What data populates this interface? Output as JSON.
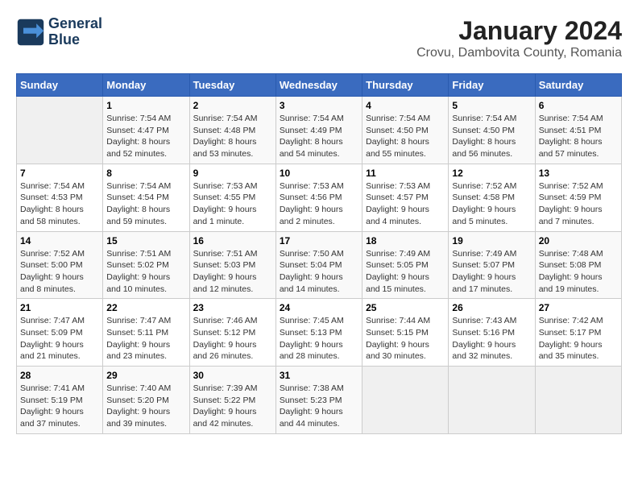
{
  "header": {
    "logo_line1": "General",
    "logo_line2": "Blue",
    "title": "January 2024",
    "subtitle": "Crovu, Dambovita County, Romania"
  },
  "weekdays": [
    "Sunday",
    "Monday",
    "Tuesday",
    "Wednesday",
    "Thursday",
    "Friday",
    "Saturday"
  ],
  "weeks": [
    [
      {
        "day": "",
        "info": ""
      },
      {
        "day": "1",
        "info": "Sunrise: 7:54 AM\nSunset: 4:47 PM\nDaylight: 8 hours\nand 52 minutes."
      },
      {
        "day": "2",
        "info": "Sunrise: 7:54 AM\nSunset: 4:48 PM\nDaylight: 8 hours\nand 53 minutes."
      },
      {
        "day": "3",
        "info": "Sunrise: 7:54 AM\nSunset: 4:49 PM\nDaylight: 8 hours\nand 54 minutes."
      },
      {
        "day": "4",
        "info": "Sunrise: 7:54 AM\nSunset: 4:50 PM\nDaylight: 8 hours\nand 55 minutes."
      },
      {
        "day": "5",
        "info": "Sunrise: 7:54 AM\nSunset: 4:50 PM\nDaylight: 8 hours\nand 56 minutes."
      },
      {
        "day": "6",
        "info": "Sunrise: 7:54 AM\nSunset: 4:51 PM\nDaylight: 8 hours\nand 57 minutes."
      }
    ],
    [
      {
        "day": "7",
        "info": "Sunrise: 7:54 AM\nSunset: 4:53 PM\nDaylight: 8 hours\nand 58 minutes."
      },
      {
        "day": "8",
        "info": "Sunrise: 7:54 AM\nSunset: 4:54 PM\nDaylight: 8 hours\nand 59 minutes."
      },
      {
        "day": "9",
        "info": "Sunrise: 7:53 AM\nSunset: 4:55 PM\nDaylight: 9 hours\nand 1 minute."
      },
      {
        "day": "10",
        "info": "Sunrise: 7:53 AM\nSunset: 4:56 PM\nDaylight: 9 hours\nand 2 minutes."
      },
      {
        "day": "11",
        "info": "Sunrise: 7:53 AM\nSunset: 4:57 PM\nDaylight: 9 hours\nand 4 minutes."
      },
      {
        "day": "12",
        "info": "Sunrise: 7:52 AM\nSunset: 4:58 PM\nDaylight: 9 hours\nand 5 minutes."
      },
      {
        "day": "13",
        "info": "Sunrise: 7:52 AM\nSunset: 4:59 PM\nDaylight: 9 hours\nand 7 minutes."
      }
    ],
    [
      {
        "day": "14",
        "info": "Sunrise: 7:52 AM\nSunset: 5:00 PM\nDaylight: 9 hours\nand 8 minutes."
      },
      {
        "day": "15",
        "info": "Sunrise: 7:51 AM\nSunset: 5:02 PM\nDaylight: 9 hours\nand 10 minutes."
      },
      {
        "day": "16",
        "info": "Sunrise: 7:51 AM\nSunset: 5:03 PM\nDaylight: 9 hours\nand 12 minutes."
      },
      {
        "day": "17",
        "info": "Sunrise: 7:50 AM\nSunset: 5:04 PM\nDaylight: 9 hours\nand 14 minutes."
      },
      {
        "day": "18",
        "info": "Sunrise: 7:49 AM\nSunset: 5:05 PM\nDaylight: 9 hours\nand 15 minutes."
      },
      {
        "day": "19",
        "info": "Sunrise: 7:49 AM\nSunset: 5:07 PM\nDaylight: 9 hours\nand 17 minutes."
      },
      {
        "day": "20",
        "info": "Sunrise: 7:48 AM\nSunset: 5:08 PM\nDaylight: 9 hours\nand 19 minutes."
      }
    ],
    [
      {
        "day": "21",
        "info": "Sunrise: 7:47 AM\nSunset: 5:09 PM\nDaylight: 9 hours\nand 21 minutes."
      },
      {
        "day": "22",
        "info": "Sunrise: 7:47 AM\nSunset: 5:11 PM\nDaylight: 9 hours\nand 23 minutes."
      },
      {
        "day": "23",
        "info": "Sunrise: 7:46 AM\nSunset: 5:12 PM\nDaylight: 9 hours\nand 26 minutes."
      },
      {
        "day": "24",
        "info": "Sunrise: 7:45 AM\nSunset: 5:13 PM\nDaylight: 9 hours\nand 28 minutes."
      },
      {
        "day": "25",
        "info": "Sunrise: 7:44 AM\nSunset: 5:15 PM\nDaylight: 9 hours\nand 30 minutes."
      },
      {
        "day": "26",
        "info": "Sunrise: 7:43 AM\nSunset: 5:16 PM\nDaylight: 9 hours\nand 32 minutes."
      },
      {
        "day": "27",
        "info": "Sunrise: 7:42 AM\nSunset: 5:17 PM\nDaylight: 9 hours\nand 35 minutes."
      }
    ],
    [
      {
        "day": "28",
        "info": "Sunrise: 7:41 AM\nSunset: 5:19 PM\nDaylight: 9 hours\nand 37 minutes."
      },
      {
        "day": "29",
        "info": "Sunrise: 7:40 AM\nSunset: 5:20 PM\nDaylight: 9 hours\nand 39 minutes."
      },
      {
        "day": "30",
        "info": "Sunrise: 7:39 AM\nSunset: 5:22 PM\nDaylight: 9 hours\nand 42 minutes."
      },
      {
        "day": "31",
        "info": "Sunrise: 7:38 AM\nSunset: 5:23 PM\nDaylight: 9 hours\nand 44 minutes."
      },
      {
        "day": "",
        "info": ""
      },
      {
        "day": "",
        "info": ""
      },
      {
        "day": "",
        "info": ""
      }
    ]
  ]
}
